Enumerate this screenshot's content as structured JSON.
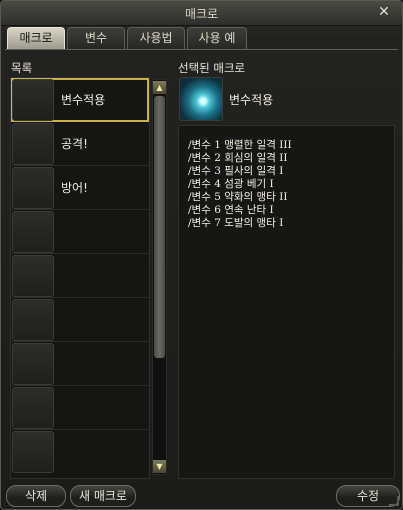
{
  "window": {
    "title": "매크로",
    "close_glyph": "✕"
  },
  "tabs": [
    {
      "label": "매크로",
      "active": true
    },
    {
      "label": "변수",
      "active": false
    },
    {
      "label": "사용법",
      "active": false
    },
    {
      "label": "사용 예",
      "active": false
    }
  ],
  "list": {
    "label": "목록",
    "items": [
      {
        "name": "변수적용",
        "icon": "wind-swirl-icon",
        "selected": true
      },
      {
        "name": "공격!",
        "icon": "burst-attack-icon",
        "selected": false
      },
      {
        "name": "방어!",
        "icon": "shield-wave-icon",
        "selected": false
      }
    ],
    "empty_slots": 6
  },
  "selected": {
    "label": "선택된 매크로",
    "name": "변수적용",
    "icon": "wind-swirl-icon",
    "lines": [
      "/변수 1 맹렬한 일격 III",
      "/변수 2 회심의 일격 II",
      "/변수 3 필사의 일격 I",
      "/변수 4 섬광 베기 I",
      "/변수 5 약화의 맹타 II",
      "/변수 6 연속 난타 I",
      "/변수 7 도발의 맹타 I"
    ]
  },
  "buttons": {
    "delete": "삭제",
    "new": "새 매크로",
    "edit": "수정"
  },
  "scroll": {
    "up_glyph": "▲",
    "down_glyph": "▼"
  },
  "colors": {
    "selection": "#c9b24a",
    "active_tab": "#d9d5c6"
  }
}
